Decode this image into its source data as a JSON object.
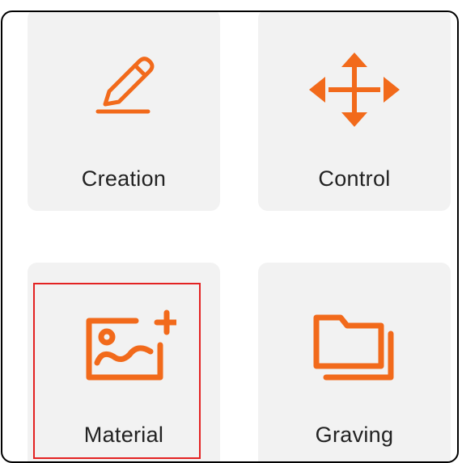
{
  "colors": {
    "accent": "#f26a1b",
    "tile_background": "#f2f2f2",
    "highlight": "#e32222"
  },
  "tiles": [
    {
      "label": "Creation",
      "icon": "pencil-icon"
    },
    {
      "label": "Control",
      "icon": "move-arrows-icon"
    },
    {
      "label": "Material",
      "icon": "add-image-icon"
    },
    {
      "label": "Graving",
      "icon": "folder-icon"
    }
  ]
}
